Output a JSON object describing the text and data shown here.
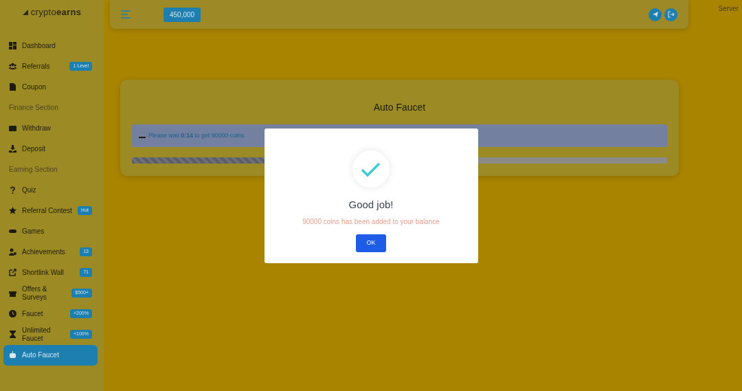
{
  "sidebar": {
    "logo": "crypto**earns**",
    "items": [
      {
        "kind": "link",
        "label": "Dashboard",
        "selected": false
      },
      {
        "kind": "link",
        "label": "Referrals",
        "badge": "1 Level",
        "selected": false
      },
      {
        "kind": "link",
        "label": "Coupon",
        "selected": false
      },
      {
        "kind": "heading",
        "label": "Finance Section"
      },
      {
        "kind": "link",
        "label": "Withdraw",
        "selected": false
      },
      {
        "kind": "link",
        "label": "Deposit",
        "selected": false
      },
      {
        "kind": "heading",
        "label": "Earning Section"
      },
      {
        "kind": "link",
        "label": "Quiz",
        "selected": false
      },
      {
        "kind": "link",
        "label": "Referral Contest",
        "badge": "Hot",
        "selected": false
      },
      {
        "kind": "link",
        "label": "Games",
        "selected": false
      },
      {
        "kind": "link",
        "label": "Achievements",
        "badge": "13",
        "selected": false
      },
      {
        "kind": "link",
        "label": "Shortlink Wall",
        "badge": "71",
        "selected": false
      },
      {
        "kind": "link",
        "label": "Offers & Surveys",
        "badge": "$500+",
        "selected": false
      },
      {
        "kind": "link",
        "label": "Faucet",
        "badge": "+200%",
        "selected": false
      },
      {
        "kind": "link",
        "label": "Unlimited Faucet",
        "badge": "+100%",
        "selected": false
      },
      {
        "kind": "link",
        "label": "Auto Faucet",
        "selected": true
      }
    ]
  },
  "topbar": {
    "balance": "450,000"
  },
  "footer_note": "Server",
  "card": {
    "title": "Auto Faucet",
    "alert": "Please wait **0:14** to get 90000 coins",
    "progress": {
      "level": 0.3
    }
  },
  "modal": {
    "title": "Good job!",
    "message": "90000 coins has been added to your balance",
    "button": "OK"
  }
}
